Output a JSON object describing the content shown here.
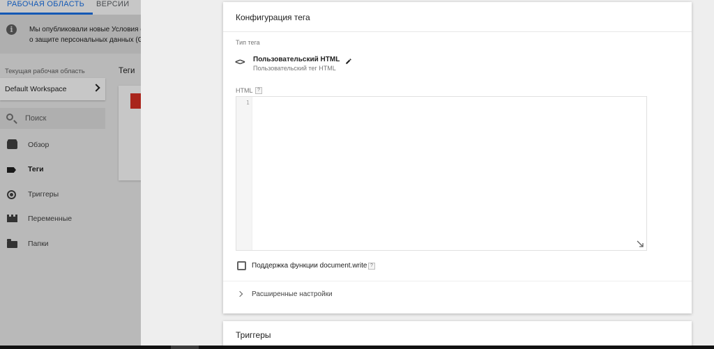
{
  "top_tabs": {
    "workspace": "РАБОЧАЯ ОБЛАСТЬ",
    "versions": "ВЕРСИИ"
  },
  "notice": {
    "line1": "Мы опубликовали новые Условия о",
    "line2": "о защите персональных данных (GI",
    "icon": "info-icon"
  },
  "sidebar": {
    "workspace_label": "Текущая рабочая область",
    "workspace_name": "Default Workspace",
    "search_placeholder": "Поиск",
    "items": [
      {
        "label": "Обзор",
        "icon": "overview-icon"
      },
      {
        "label": "Теги",
        "icon": "tag-icon",
        "active": true
      },
      {
        "label": "Триггеры",
        "icon": "trigger-icon"
      },
      {
        "label": "Переменные",
        "icon": "variables-icon"
      },
      {
        "label": "Папки",
        "icon": "folder-icon"
      }
    ]
  },
  "list": {
    "title": "Теги"
  },
  "tag_config": {
    "title": "Конфигурация тега",
    "tag_type_label": "Тип тега",
    "tag_type_name": "Пользовательский HTML",
    "tag_type_sub": "Пользовательский тег HTML",
    "html_label": "HTML",
    "help_glyph": "?",
    "editor_line_number": "1",
    "editor_content": "",
    "document_write_label": "Поддержка функции document.write",
    "document_write_checked": false,
    "advanced_label": "Расширенные настройки"
  },
  "triggers": {
    "title": "Триггеры"
  },
  "colors": {
    "accent": "#1a73e8",
    "tag_red": "#d93025"
  }
}
